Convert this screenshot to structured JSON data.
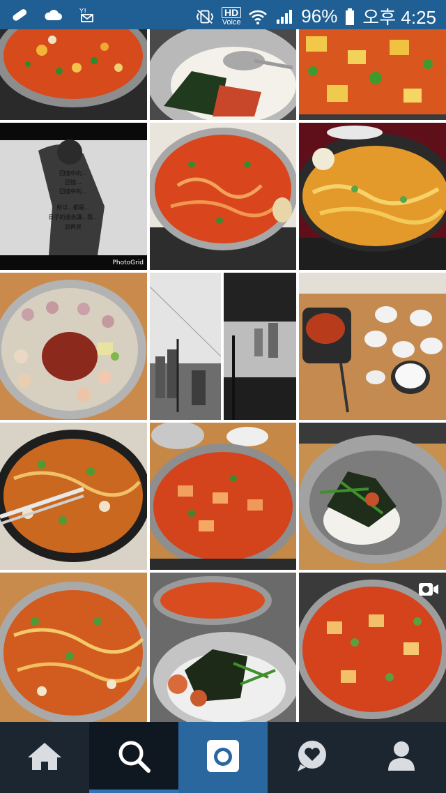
{
  "status_bar": {
    "left_icons": [
      "bandage-icon",
      "cloud-icon",
      "yahoo-mail-icon"
    ],
    "hd_label": "HD",
    "voice_label": "Voice",
    "battery_percent": "96%",
    "time": "오후 4:25"
  },
  "grid": {
    "tiles": [
      {
        "name": "photo-stew-pot"
      },
      {
        "name": "photo-rice-bowl-seaweed"
      },
      {
        "name": "photo-stew-closeup"
      },
      {
        "name": "photo-collage-poem"
      },
      {
        "name": "photo-stew-pot-red"
      },
      {
        "name": "photo-stew-noodles-egg"
      },
      {
        "name": "photo-octopus-shrimp-pot"
      },
      {
        "name": "photo-city-view-collage"
      },
      {
        "name": "photo-table-side-dishes"
      },
      {
        "name": "photo-stew-tongs"
      },
      {
        "name": "photo-stew-pot-table"
      },
      {
        "name": "photo-rice-bowl-greens"
      },
      {
        "name": "photo-stew-pot-greens"
      },
      {
        "name": "photo-bowl-octopus-seaweed"
      },
      {
        "name": "photo-stew-video"
      }
    ],
    "collage": {
      "poem_lines": [
        "回憶中的...",
        "回憶...",
        "回憶中的...",
        "所以...都是...",
        "日子的過去讓...我...",
        "說再見"
      ],
      "watermark": "PhotoGrid"
    }
  },
  "nav": {
    "items": [
      {
        "name": "nav-home",
        "icon": "home-icon"
      },
      {
        "name": "nav-search",
        "icon": "search-icon",
        "active": true
      },
      {
        "name": "nav-camera",
        "icon": "camera-icon"
      },
      {
        "name": "nav-activity",
        "icon": "heart-bubble-icon"
      },
      {
        "name": "nav-profile",
        "icon": "profile-icon"
      }
    ]
  },
  "colors": {
    "status_bar": "#1f5f94",
    "nav_bar": "#1b2631",
    "camera_tab": "#2b679f",
    "active_indicator": "#2f73b5"
  }
}
